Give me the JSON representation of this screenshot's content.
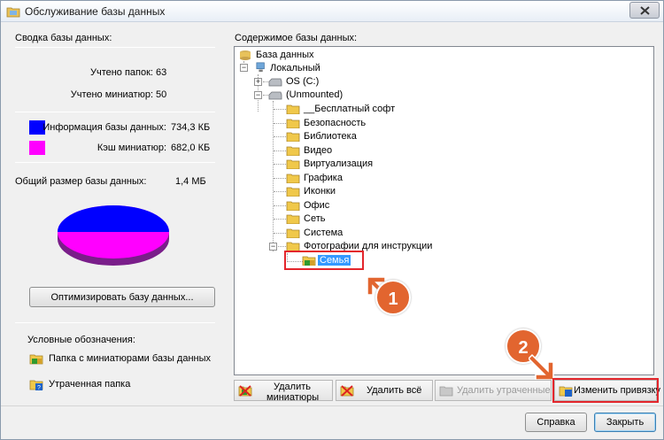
{
  "window": {
    "title": "Обслуживание базы данных"
  },
  "summary": {
    "title": "Сводка базы данных:",
    "folders_label": "Учтено папок:",
    "folders_value": "63",
    "thumbs_label": "Учтено миниатюр:",
    "thumbs_value": "50",
    "db_info_label": "Информация базы данных:",
    "db_info_value": "734,3 КБ",
    "db_info_color": "#0000ff",
    "cache_label": "Кэш миниатюр:",
    "cache_value": "682,0 КБ",
    "cache_color": "#ff00ff",
    "total_label": "Общий размер базы данных:",
    "total_value": "1,4 МБ",
    "optimize_button": "Оптимизировать базу данных..."
  },
  "legend": {
    "title": "Условные обозначения:",
    "items": [
      {
        "icon": "folder-thumbnails-icon",
        "label": "Папка с миниатюрами базы данных"
      },
      {
        "icon": "lost-folder-icon",
        "label": "Утраченная папка"
      }
    ]
  },
  "contents": {
    "title": "Содержимое базы данных:",
    "root": "База данных",
    "local": "Локальный",
    "drive_c": "OS (C:)",
    "unmounted": "(Unmounted)",
    "folders": [
      "__Бесплатный софт",
      "Безопасность",
      "Библиотека",
      "Видео",
      "Виртуализация",
      "Графика",
      "Иконки",
      "Офис",
      "Сеть",
      "Система",
      "Фотографии для инструкции"
    ],
    "selected": "Семья"
  },
  "toolbar": {
    "delete_thumbs_line1": "Удалить",
    "delete_thumbs_line2": "миниатюры",
    "delete_all": "Удалить всё",
    "delete_lost": "Удалить утраченные",
    "change_binding": "Изменить привязку"
  },
  "footer": {
    "help": "Справка",
    "close": "Закрыть"
  },
  "annotations": {
    "step1": "1",
    "step2": "2",
    "highlight_color": "#e3262c",
    "badge_color": "#e2652f"
  }
}
